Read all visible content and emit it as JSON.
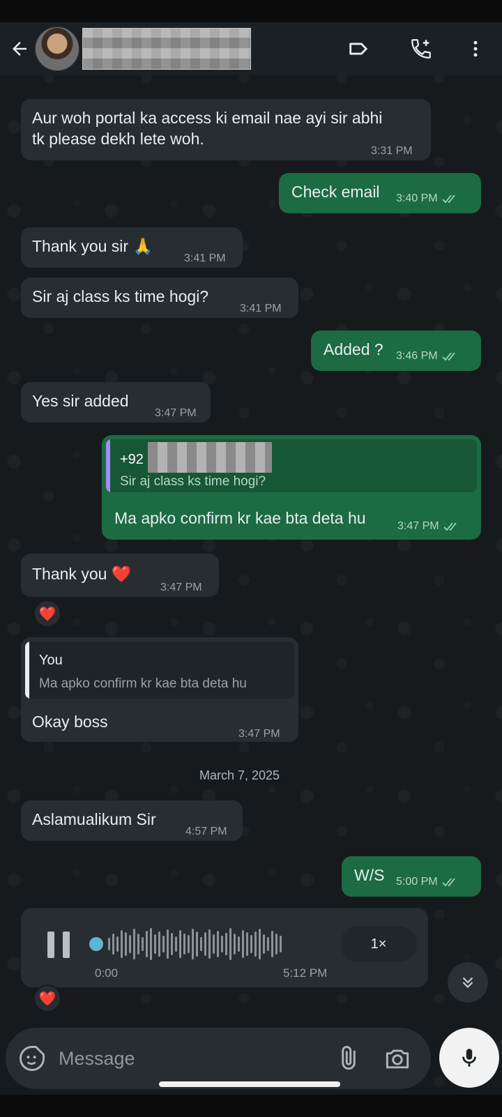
{
  "header": {
    "contact_name": "",
    "icons": [
      "back-arrow-icon",
      "label-icon",
      "add-call-icon",
      "more-vert-icon"
    ]
  },
  "messages": [
    {
      "id": "m1",
      "dir": "in",
      "lines": [
        "Aur woh portal ka access ki email nae ayi sir abhi",
        "tk please dekh lete woh."
      ],
      "time": "3:31 PM"
    },
    {
      "id": "m2",
      "dir": "out",
      "text": "Check email",
      "time": "3:40 PM",
      "status": "read"
    },
    {
      "id": "m3",
      "dir": "in",
      "text": "Thank you sir 🙏",
      "time": "3:41 PM"
    },
    {
      "id": "m4",
      "dir": "in",
      "text": "Sir aj class ks time hogi?",
      "time": "3:41 PM"
    },
    {
      "id": "m5",
      "dir": "out",
      "text": "Added ?",
      "time": "3:46 PM",
      "status": "read"
    },
    {
      "id": "m6",
      "dir": "in",
      "text": "Yes sir added",
      "time": "3:47 PM"
    },
    {
      "id": "m7",
      "dir": "out",
      "quote": {
        "name": "+92",
        "text": "Sir aj class ks time hogi?"
      },
      "text": "Ma apko confirm kr kae bta deta hu",
      "time": "3:47 PM",
      "status": "read"
    },
    {
      "id": "m8",
      "dir": "in",
      "text": "Thank you ❤️",
      "time": "3:47 PM",
      "reaction": "❤️"
    },
    {
      "id": "m9",
      "dir": "in",
      "quote": {
        "name": "You",
        "text": "Ma apko confirm kr kae bta deta hu"
      },
      "text": "Okay boss",
      "time": "3:47 PM"
    },
    {
      "id": "m10",
      "dir": "in",
      "text": "Aslamualikum Sir",
      "time": "4:57 PM"
    },
    {
      "id": "m11",
      "dir": "out",
      "text": "W/S",
      "time": "5:00 PM",
      "status": "read"
    }
  ],
  "date_separator": "March 7, 2025",
  "voice_message": {
    "duration": "0:00",
    "time": "5:12 PM",
    "speed": "1×",
    "progress": 0.0,
    "reaction": "❤️"
  },
  "composer": {
    "placeholder": "Message",
    "value": ""
  },
  "colors": {
    "incoming_bubble": "#272d31",
    "outgoing_bubble": "#1c6b42",
    "quote_bar_outgoing": "#a78bfa",
    "quote_name_outgoing": "#ffffff",
    "quote_bar_incoming": "#e9edef",
    "read_ticks": "#9fd3b5"
  }
}
